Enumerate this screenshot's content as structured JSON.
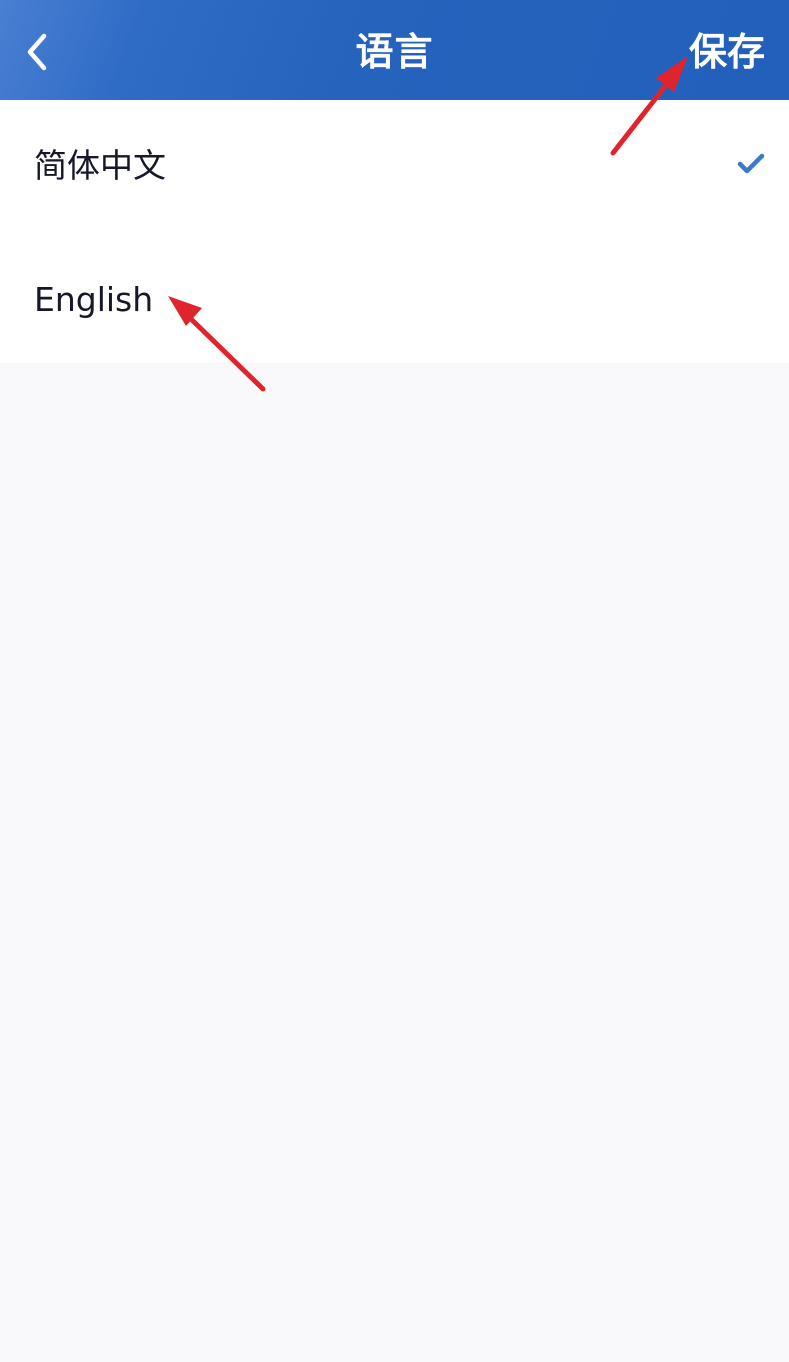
{
  "header": {
    "title": "语言",
    "save_label": "保存",
    "background_color": "#2563bd",
    "back_icon": "chevron-left-icon"
  },
  "languages": [
    {
      "label": "简体中文",
      "selected": true
    },
    {
      "label": "English",
      "selected": false
    }
  ],
  "colors": {
    "checkmark": "#3d78c9",
    "annotation_arrow": "#e0242e",
    "list_background": "#ffffff",
    "page_background": "#f9f9fb"
  },
  "icons": {
    "selected": "check-icon"
  }
}
